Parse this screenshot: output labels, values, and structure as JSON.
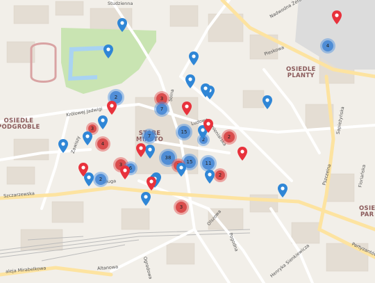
{
  "map": {
    "districts": [
      {
        "id": "stare-miasto",
        "lines": [
          "STARE",
          "MIASTO"
        ]
      },
      {
        "id": "osiedle-planty",
        "lines": [
          "OSIEDLE",
          "PLANTY"
        ]
      },
      {
        "id": "osiedle-podgroble",
        "lines": [
          "OSIEDLE",
          "PODGROBLE"
        ]
      },
      {
        "id": "osiedle-par",
        "lines": [
          "OSIE",
          "PAR"
        ]
      }
    ],
    "streets": [
      {
        "id": "studzienna",
        "text": "Studzienna"
      },
      {
        "id": "nadwodna-zeromy",
        "text": "Nadwodna Żeromy"
      },
      {
        "id": "pieskowa",
        "text": "Pieskowa"
      },
      {
        "id": "krolowej-jadwigi",
        "text": "Królowej Jadwigi"
      },
      {
        "id": "ludowa",
        "text": "Ludowa"
      },
      {
        "id": "kamieniarska",
        "text": "Kamieniarska"
      },
      {
        "id": "zawiszy",
        "text": "Zawiszy"
      },
      {
        "id": "sczarzewska",
        "text": "Szczarzewska"
      },
      {
        "id": "aleja-mirabelkowa",
        "text": "aleja Mirabelkowa"
      },
      {
        "id": "altanowa",
        "text": "Altanowa"
      },
      {
        "id": "olszowa",
        "text": "Olszowa"
      },
      {
        "id": "pogodna",
        "text": "Pogodna"
      },
      {
        "id": "henryka-sienkiewicza",
        "text": "Henryka Sienkiewicza"
      },
      {
        "id": "partyzantow",
        "text": "Partyzantów"
      },
      {
        "id": "ogrodowa",
        "text": "Ogrodowa"
      },
      {
        "id": "solna",
        "text": "Solna"
      },
      {
        "id": "dluga",
        "text": "Długa"
      },
      {
        "id": "sapiezynska",
        "text": "Sapieżyńska"
      },
      {
        "id": "florianska",
        "text": "Floriańska"
      },
      {
        "id": "pszczelna",
        "text": "Pszczelna"
      }
    ],
    "clusters": [
      {
        "id": "c4-planty",
        "count": "4",
        "color": "blue"
      },
      {
        "id": "c2-west",
        "count": "2",
        "color": "blue"
      },
      {
        "id": "c3-north",
        "count": "3",
        "color": "red"
      },
      {
        "id": "c7",
        "count": "7",
        "color": "blue"
      },
      {
        "id": "c15-a",
        "count": "15",
        "color": "blue"
      },
      {
        "id": "c2-east",
        "count": "2",
        "color": "red"
      },
      {
        "id": "c3-red-west",
        "count": "3",
        "color": "red"
      },
      {
        "id": "c4-red",
        "count": "4",
        "color": "red"
      },
      {
        "id": "c7-b",
        "count": "7",
        "color": "blue"
      },
      {
        "id": "c15-b",
        "count": "15",
        "color": "blue"
      },
      {
        "id": "c11",
        "count": "11",
        "color": "blue"
      },
      {
        "id": "c38",
        "count": "38",
        "color": "blue"
      },
      {
        "id": "c3-red-center",
        "count": "3",
        "color": "red"
      },
      {
        "id": "c6",
        "count": "6",
        "color": "blue"
      },
      {
        "id": "c2-red-mid",
        "count": "2",
        "color": "red"
      },
      {
        "id": "c2-blue-sw",
        "count": "2",
        "color": "blue"
      },
      {
        "id": "c2-red-right",
        "count": "2",
        "color": "red"
      },
      {
        "id": "c3-red-south",
        "count": "3",
        "color": "red"
      },
      {
        "id": "c2-blue-center",
        "count": "2",
        "color": "blue"
      }
    ],
    "pins": [
      {
        "id": "pin-1",
        "color": "blue"
      },
      {
        "id": "pin-2",
        "color": "blue"
      },
      {
        "id": "pin-3",
        "color": "blue"
      },
      {
        "id": "pin-4",
        "color": "blue"
      },
      {
        "id": "pin-5",
        "color": "blue"
      },
      {
        "id": "pin-6",
        "color": "blue"
      },
      {
        "id": "pin-7",
        "color": "blue"
      },
      {
        "id": "pin-8",
        "color": "blue"
      },
      {
        "id": "pin-9",
        "color": "blue"
      },
      {
        "id": "pin-10",
        "color": "blue"
      },
      {
        "id": "pin-11",
        "color": "blue"
      },
      {
        "id": "pin-12",
        "color": "blue"
      },
      {
        "id": "pin-13",
        "color": "blue"
      },
      {
        "id": "pin-14",
        "color": "blue"
      },
      {
        "id": "pin-15",
        "color": "blue"
      },
      {
        "id": "pin-16",
        "color": "blue"
      },
      {
        "id": "pin-17",
        "color": "blue"
      },
      {
        "id": "pin-18",
        "color": "blue"
      },
      {
        "id": "pin-19",
        "color": "blue"
      },
      {
        "id": "pin-20",
        "color": "red"
      },
      {
        "id": "pin-21",
        "color": "red"
      },
      {
        "id": "pin-22",
        "color": "red"
      },
      {
        "id": "pin-23",
        "color": "red"
      },
      {
        "id": "pin-24",
        "color": "red"
      },
      {
        "id": "pin-25",
        "color": "red"
      },
      {
        "id": "pin-26",
        "color": "red"
      },
      {
        "id": "pin-27",
        "color": "red"
      },
      {
        "id": "pin-28",
        "color": "red"
      }
    ],
    "colors": {
      "blue_marker": "#2f86d6",
      "red_marker": "#e8323c",
      "park": "#c8e6b4",
      "water": "#a9d3f2",
      "road": "#ffffff",
      "major_road": "#fde8a6",
      "building": "#e3dcd3"
    }
  }
}
